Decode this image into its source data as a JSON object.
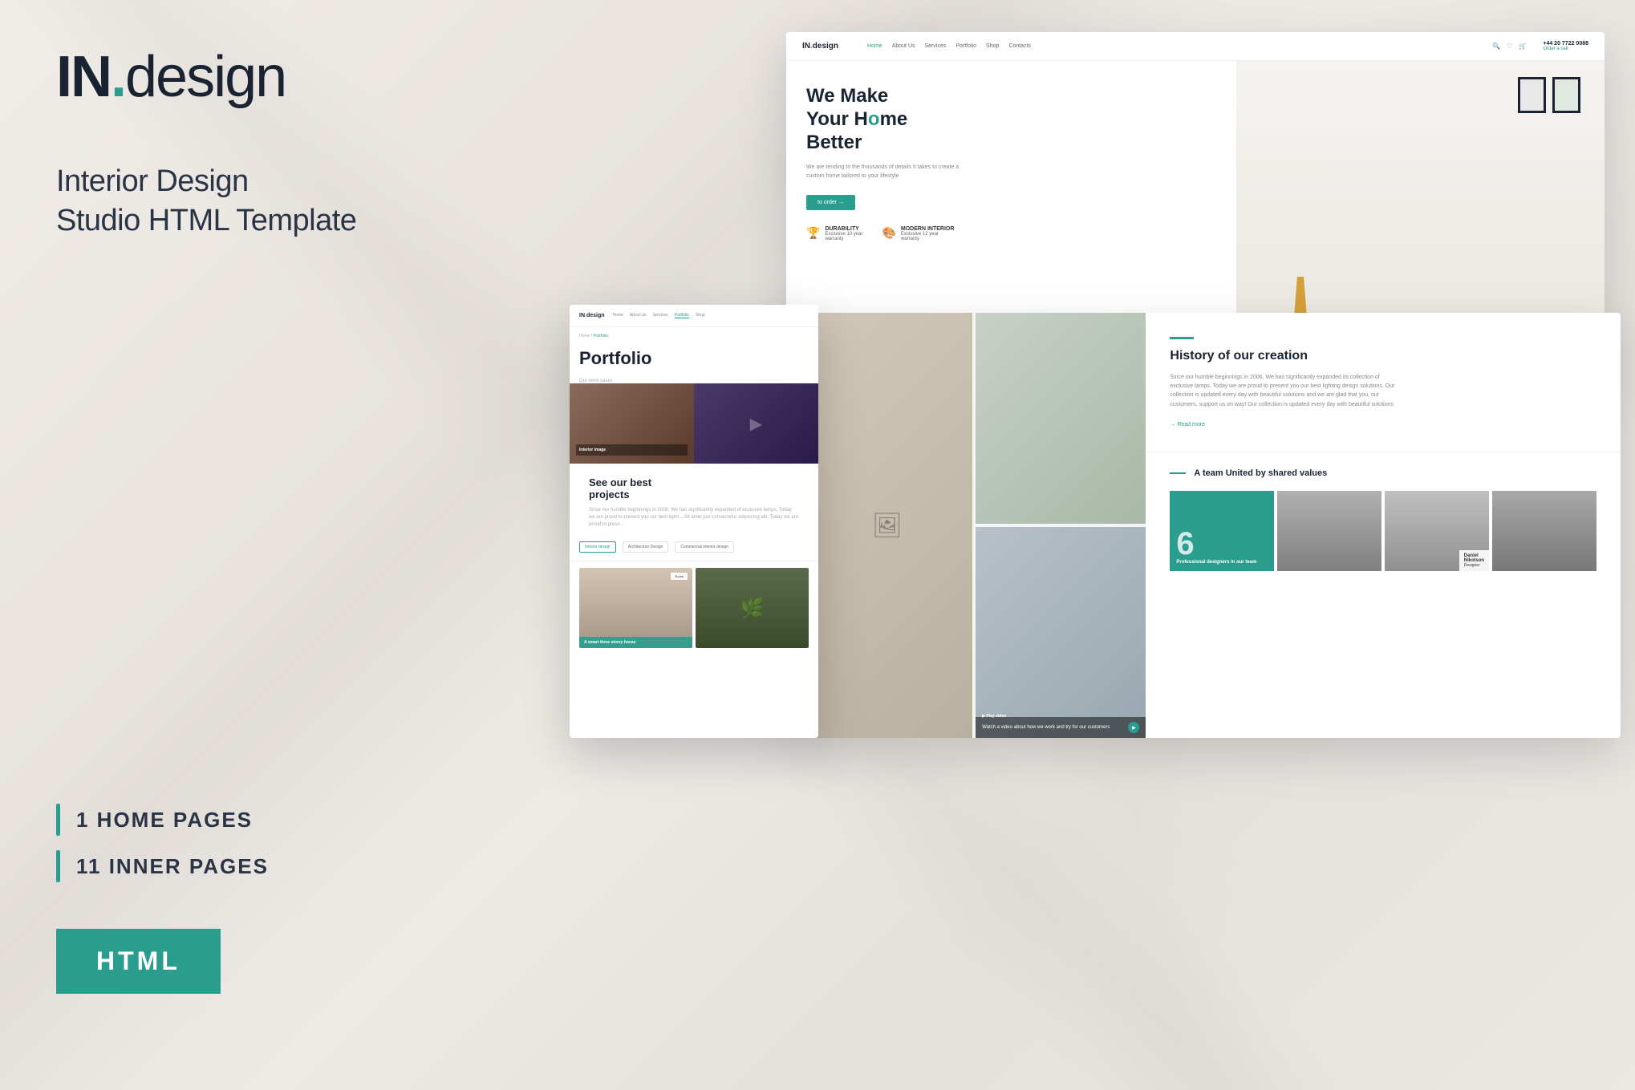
{
  "logo": {
    "brand": "IN",
    "dot": ".",
    "design": "design"
  },
  "tagline": "Interior Design\nStudio HTML Template",
  "stats": [
    {
      "label": "1 HOME PAGES"
    },
    {
      "label": "11 INNER PAGES"
    }
  ],
  "badge": {
    "label": "HTML"
  },
  "home_mockup": {
    "nav": {
      "logo": "IN.design",
      "links": [
        "Home",
        "About Us",
        "Services",
        "Portfolio",
        "Shop",
        "Contacts"
      ],
      "phone": "+44 20 7722 0088",
      "order": "Order a call"
    },
    "hero": {
      "title_line1": "We Make",
      "title_line2": "Your H",
      "title_highlight": "o",
      "title_line3": "me",
      "title_line4": "Better",
      "subtitle": "We are tending to the thousands of details it takes to create a custom home tailored to your lifestyle",
      "cta": "to order →"
    },
    "features": [
      {
        "icon": "🏆",
        "title": "DURABILITY",
        "desc": "Exclusive 10 year\nwarranty"
      },
      {
        "icon": "🎨",
        "title": "MODERN INTERIOR",
        "desc": "Exclusive 12 year\nwarranty"
      }
    ]
  },
  "about_mockup": {
    "history": {
      "line": "",
      "title": "History of our creation",
      "desc": "Since our humble beginnings in 2006, We has significantly expanded its collection of exclusive lamps. Today we are proud to present you our best lighting design solutions. Our collection is updated every day with beautiful solutions and we are glad that you, our customers, support us on way! Our collection is updated every day with beautiful solutions",
      "read_more": "→ Read more"
    },
    "video": {
      "text": "Watch a video about how we\nwork and try for our customers",
      "play": "▶ Play video"
    },
    "team": {
      "title": "A team United by shared values",
      "number": "6",
      "role": "Professional designers\nin our team",
      "members": [
        {
          "name": "Daniel\nNikolson",
          "role": "Designer"
        }
      ]
    }
  },
  "portfolio_mockup": {
    "nav": {
      "logo": "IN.design",
      "links": [
        "Home",
        "About Us",
        "Services",
        "Portfolio",
        "Shop"
      ]
    },
    "breadcrumb": "Home / Portfolio",
    "title": "Portfolio",
    "subtitle": "Our work cases",
    "tabs": [
      "Interior design",
      "Architecture Design",
      "Commercial interior design"
    ],
    "projects": {
      "title": "See our best\nprojects",
      "desc": "Since our humble beginnings in 2006, We has significantly expanded of exclusive lamps. Today we are proud to present you our best lighti... Sit amet just consectetur adipiscing elit. Today we are proud to prese..."
    },
    "items": [
      {
        "label": "A smart three\nstorey house",
        "badge": "Room"
      },
      {
        "label": "",
        "badge": ""
      },
      {
        "label": "",
        "badge": ""
      },
      {
        "label": "",
        "badge": ""
      }
    ]
  }
}
